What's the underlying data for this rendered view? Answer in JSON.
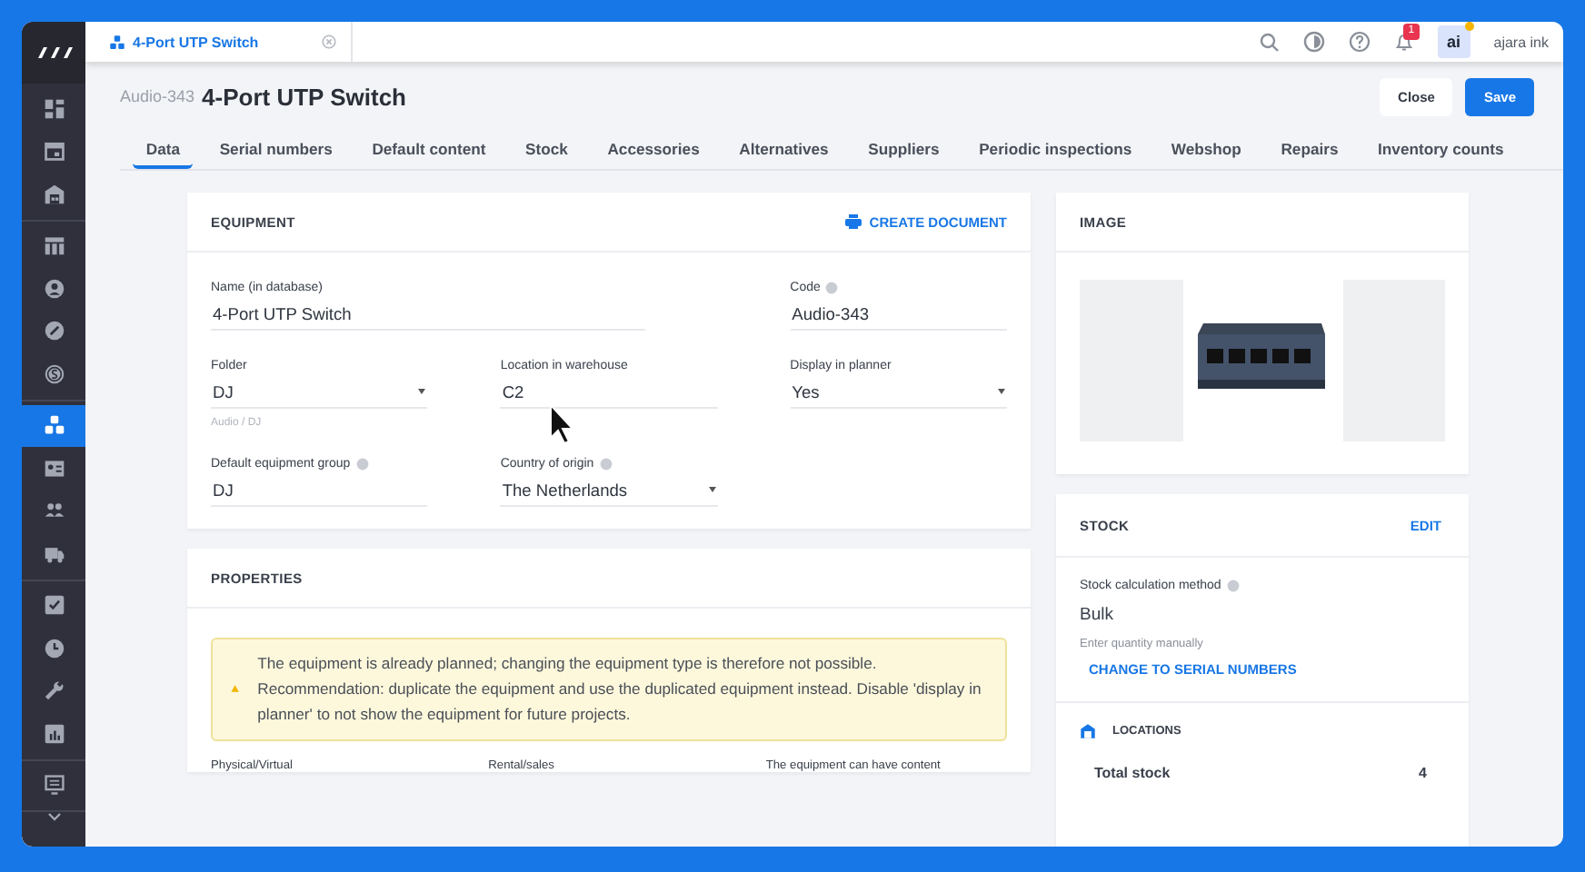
{
  "top_bar": {
    "tab_title": "4-Port UTP Switch",
    "notification_count": "1",
    "avatar": "ai",
    "user_name": "ajara ink"
  },
  "sidebar": {
    "groups": [
      {
        "items": [
          {
            "selected": false
          },
          {
            "selected": false
          },
          {
            "selected": false
          }
        ]
      },
      {
        "items": [
          {
            "selected": false
          },
          {
            "selected": false
          },
          {
            "selected": false
          },
          {
            "selected": false
          }
        ]
      },
      {
        "items": [
          {
            "selected": true
          },
          {
            "selected": false
          },
          {
            "selected": false
          },
          {
            "selected": false
          }
        ]
      },
      {
        "items": [
          {
            "selected": false
          },
          {
            "selected": false
          },
          {
            "selected": false
          },
          {
            "selected": false
          }
        ]
      },
      {
        "items": [
          {
            "selected": false
          }
        ]
      }
    ]
  },
  "header": {
    "code": "Audio-343",
    "title": "4-Port UTP Switch",
    "buttons": [
      {
        "label": "Close",
        "kind": "secondary"
      },
      {
        "label": "Save",
        "kind": "primary"
      }
    ]
  },
  "tabs": [
    {
      "label": "Data",
      "selected": true
    },
    {
      "label": "Serial numbers",
      "selected": false
    },
    {
      "label": "Default content",
      "selected": false
    },
    {
      "label": "Stock",
      "selected": false
    },
    {
      "label": "Accessories",
      "selected": false
    },
    {
      "label": "Alternatives",
      "selected": false
    },
    {
      "label": "Suppliers",
      "selected": false
    },
    {
      "label": "Periodic inspections",
      "selected": false
    },
    {
      "label": "Webshop",
      "selected": false
    },
    {
      "label": "Repairs",
      "selected": false
    },
    {
      "label": "Inventory counts",
      "selected": false
    }
  ],
  "equipment": {
    "title": "EQUIPMENT",
    "action": "CREATE DOCUMENT",
    "rows": [
      [
        {
          "label": "Name (in database)",
          "value": "4-Port UTP Switch",
          "kind": "text",
          "info": false
        },
        "",
        {
          "label": "Code",
          "value": "Audio-343",
          "kind": "text",
          "info": true
        }
      ],
      [
        {
          "label": "Folder",
          "value": "DJ",
          "kind": "select",
          "info": false,
          "hint": "Audio / DJ"
        },
        {
          "label": "Location in warehouse",
          "value": "C2",
          "kind": "text",
          "info": false
        },
        {
          "label": "Display in planner",
          "value": "Yes",
          "kind": "select",
          "info": false
        }
      ],
      [
        {
          "label": "Default equipment group",
          "value": "DJ",
          "kind": "text",
          "info": true
        },
        {
          "label": "Country of origin",
          "value": "The Netherlands",
          "kind": "select",
          "info": true
        }
      ]
    ]
  },
  "properties": {
    "title": "PROPERTIES",
    "alert": "The equipment is already planned; changing the equipment type is therefore not possible. Recommendation: duplicate the equipment and use the duplicated equipment instead. Disable 'display in planner' to not show the equipment for future projects.",
    "columns": [
      "Physical/Virtual",
      "Rental/sales",
      "The equipment can have content"
    ]
  },
  "image": {
    "title": "IMAGE",
    "kind": "picture"
  },
  "stock": {
    "title": "STOCK",
    "action": "EDIT",
    "method_label": "Stock calculation method",
    "method_value": "Bulk",
    "method_hint": "Enter quantity manually",
    "link": "CHANGE TO SERIAL NUMBERS",
    "locations_title": "LOCATIONS",
    "rows": [
      {
        "label": "Total stock",
        "value": "4"
      }
    ]
  }
}
